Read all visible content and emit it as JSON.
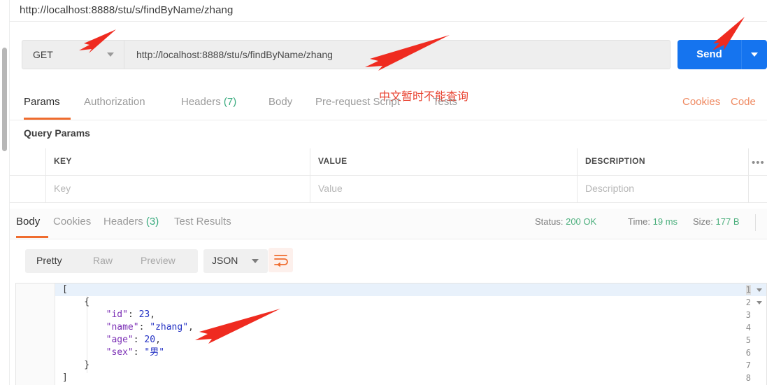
{
  "window": {
    "url_bar_text": "http://localhost:8888/stu/s/findByName/zhang"
  },
  "request": {
    "method": "GET",
    "url_value": "http://localhost:8888/stu/s/findByName/zhang",
    "send_label": "Send",
    "annotation_note": "中文暂时不能查询",
    "tabs": [
      {
        "label": "Params",
        "count": "",
        "active": true
      },
      {
        "label": "Authorization",
        "count": "",
        "active": false
      },
      {
        "label": "Headers",
        "count": "(7)",
        "active": false
      },
      {
        "label": "Body",
        "count": "",
        "active": false
      },
      {
        "label": "Pre-request Script",
        "count": "",
        "active": false
      },
      {
        "label": "Tests",
        "count": "",
        "active": false
      }
    ],
    "right_links": [
      "Cookies",
      "Code"
    ]
  },
  "query_params": {
    "section_title": "Query Params",
    "columns": [
      "KEY",
      "VALUE",
      "DESCRIPTION"
    ],
    "bulk_edit_icon": "•••",
    "row_placeholders": [
      "Key",
      "Value",
      "Description"
    ]
  },
  "response": {
    "tabs": [
      {
        "label": "Body",
        "count": "",
        "active": true
      },
      {
        "label": "Cookies",
        "count": "",
        "active": false
      },
      {
        "label": "Headers",
        "count": "(3)",
        "active": false
      },
      {
        "label": "Test Results",
        "count": "",
        "active": false
      }
    ],
    "meta": {
      "status_label": "Status:",
      "status_value": "200 OK",
      "time_label": "Time:",
      "time_value": "19 ms",
      "size_label": "Size:",
      "size_value": "177 B"
    },
    "format_tabs": [
      {
        "label": "Pretty",
        "active": true
      },
      {
        "label": "Raw",
        "active": false
      },
      {
        "label": "Preview",
        "active": false
      }
    ],
    "language": "JSON",
    "wrap_icon": "word-wrap-icon",
    "body_lines": [
      {
        "n": "1",
        "fold": true,
        "segments": [
          {
            "t": "[",
            "c": "punct"
          }
        ]
      },
      {
        "n": "2",
        "fold": true,
        "segments": [
          {
            "t": "    {",
            "c": "punct"
          }
        ]
      },
      {
        "n": "3",
        "fold": false,
        "segments": [
          {
            "t": "        ",
            "c": "punct"
          },
          {
            "t": "\"id\"",
            "c": "key"
          },
          {
            "t": ": ",
            "c": "punct"
          },
          {
            "t": "23",
            "c": "num"
          },
          {
            "t": ",",
            "c": "punct"
          }
        ]
      },
      {
        "n": "4",
        "fold": false,
        "segments": [
          {
            "t": "        ",
            "c": "punct"
          },
          {
            "t": "\"name\"",
            "c": "key"
          },
          {
            "t": ": ",
            "c": "punct"
          },
          {
            "t": "\"zhang\"",
            "c": "str"
          },
          {
            "t": ",",
            "c": "punct"
          }
        ]
      },
      {
        "n": "5",
        "fold": false,
        "segments": [
          {
            "t": "        ",
            "c": "punct"
          },
          {
            "t": "\"age\"",
            "c": "key"
          },
          {
            "t": ": ",
            "c": "punct"
          },
          {
            "t": "20",
            "c": "num"
          },
          {
            "t": ",",
            "c": "punct"
          }
        ]
      },
      {
        "n": "6",
        "fold": false,
        "segments": [
          {
            "t": "        ",
            "c": "punct"
          },
          {
            "t": "\"sex\"",
            "c": "key"
          },
          {
            "t": ": ",
            "c": "punct"
          },
          {
            "t": "\"男\"",
            "c": "str"
          }
        ]
      },
      {
        "n": "7",
        "fold": false,
        "segments": [
          {
            "t": "    }",
            "c": "punct"
          }
        ]
      },
      {
        "n": "8",
        "fold": false,
        "segments": [
          {
            "t": "]",
            "c": "punct"
          }
        ]
      }
    ]
  },
  "colors": {
    "accent_orange": "#ef6c2e",
    "send_blue": "#1574ef",
    "success_green": "#4caf7d",
    "annotation_red": "#e8412f",
    "link_salmon": "#ef8a62"
  }
}
